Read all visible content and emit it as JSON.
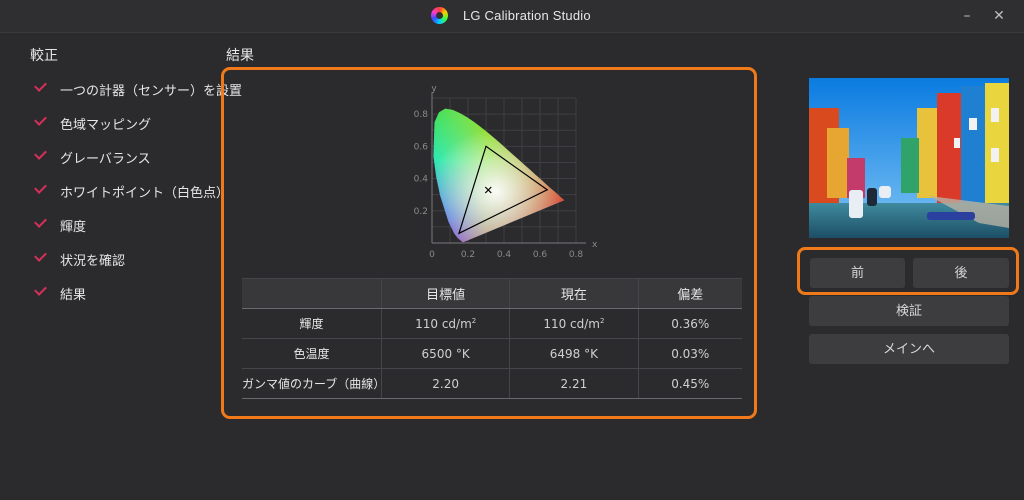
{
  "window": {
    "title": "LG Calibration Studio",
    "minimize_glyph": "–",
    "close_glyph": "✕"
  },
  "sidebar": {
    "heading": "較正",
    "steps": [
      {
        "label": "一つの計器（センサー）を設置",
        "done": true
      },
      {
        "label": "色域マッピング",
        "done": true
      },
      {
        "label": "グレーバランス",
        "done": true
      },
      {
        "label": "ホワイトポイント（白色点）",
        "done": true
      },
      {
        "label": "輝度",
        "done": true
      },
      {
        "label": "状況を確認",
        "done": true
      },
      {
        "label": "結果",
        "done": true
      }
    ]
  },
  "results": {
    "heading": "結果",
    "table": {
      "headers": [
        "",
        "目標値",
        "現在",
        "偏差"
      ],
      "rows": [
        {
          "label": "輝度",
          "target": "110  cd/m",
          "target_sup": "2",
          "current": "110  cd/m",
          "current_sup": "2",
          "deviation": "0.36%"
        },
        {
          "label": "色温度",
          "target": "6500 °K",
          "target_sup": "",
          "current": "6498 °K",
          "current_sup": "",
          "deviation": "0.03%"
        },
        {
          "label": "ガンマ値のカーブ（曲線）",
          "target": "2.20",
          "target_sup": "",
          "current": "2.21",
          "current_sup": "",
          "deviation": "0.45%"
        }
      ]
    }
  },
  "chart_data": {
    "type": "scatter",
    "xlabel": "x",
    "ylabel": "y",
    "xlim": [
      0,
      0.8
    ],
    "ylim": [
      0,
      0.9
    ],
    "x_ticks": [
      "0",
      "0.2",
      "0.4",
      "0.6",
      "0.8"
    ],
    "y_ticks": [
      "0.2",
      "0.4",
      "0.6",
      "0.8"
    ],
    "grid": true,
    "gamut_triangle": [
      [
        0.64,
        0.33
      ],
      [
        0.3,
        0.6
      ],
      [
        0.15,
        0.06
      ]
    ],
    "white_point": [
      0.3127,
      0.329
    ]
  },
  "navigation": {
    "prev": "前",
    "next": "後",
    "verify": "検証",
    "main": "メインへ"
  },
  "colors": {
    "accent": "#f07a1a",
    "check": "#d6305a",
    "background": "#2b2b2d"
  }
}
